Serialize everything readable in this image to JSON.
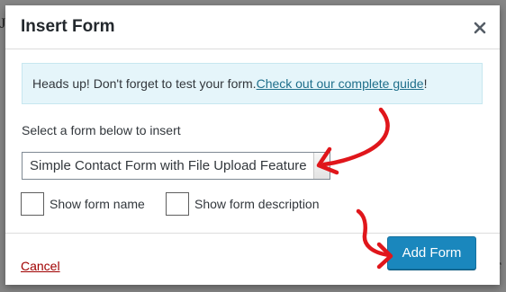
{
  "modal": {
    "title": "Insert Form",
    "close_icon": "close-icon"
  },
  "notice": {
    "text": "Heads up! Don't forget to test your form. ",
    "link_text": "Check out our complete guide",
    "suffix": "!"
  },
  "form_picker": {
    "label": "Select a form below to insert",
    "selected_value": "Simple Contact Form with File Upload Feature",
    "arrow_icon": "chevron-down-icon"
  },
  "options": {
    "show_name_label": "Show form name",
    "show_description_label": "Show form description",
    "show_name_checked": false,
    "show_description_checked": false
  },
  "footer": {
    "cancel_label": "Cancel",
    "add_form_label": "Add Form"
  },
  "colors": {
    "accent": "#1a87bd",
    "annotation_arrow": "#e0161b",
    "notice_bg": "#e5f5fa",
    "cancel_text": "#a00000"
  }
}
